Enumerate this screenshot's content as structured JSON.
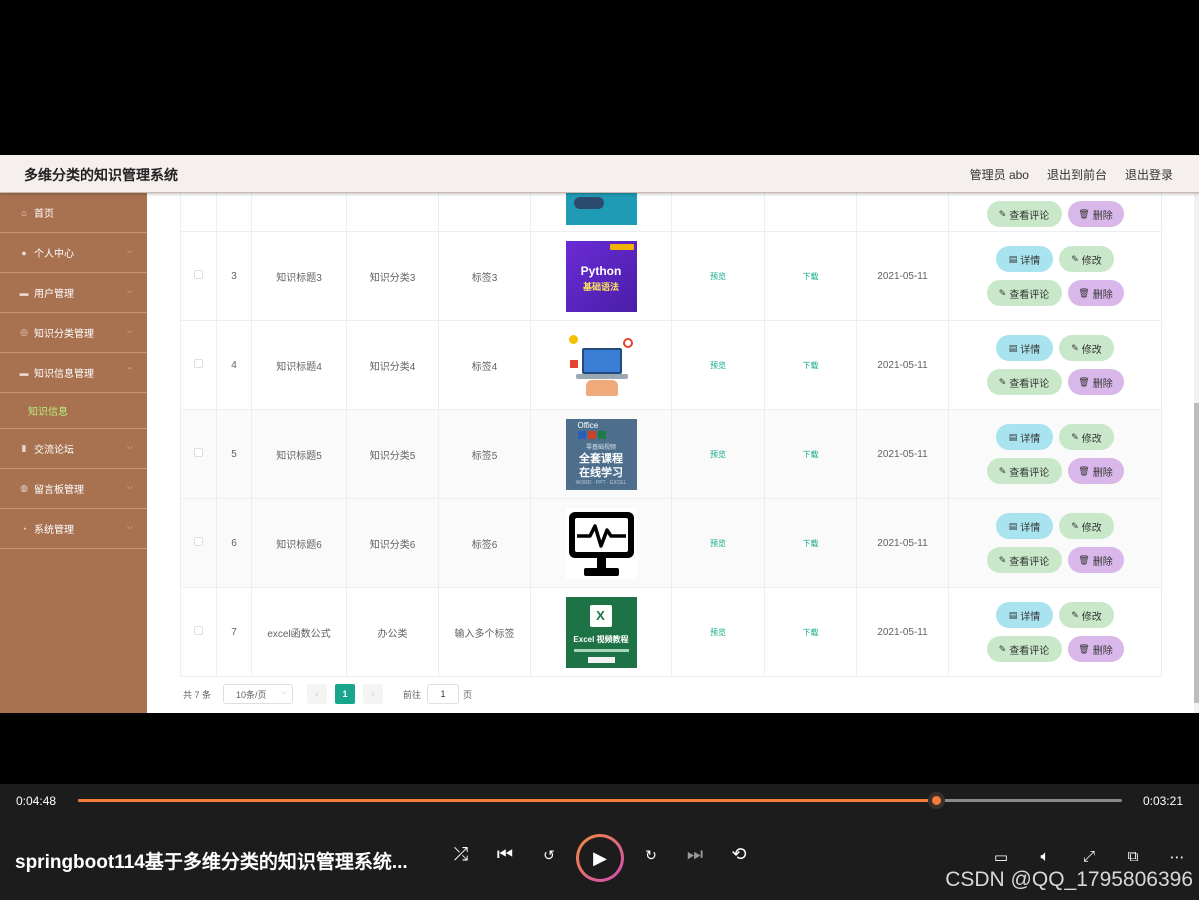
{
  "header": {
    "app_title": "多维分类的知识管理系统",
    "user_label": "管理员 abo",
    "front_link": "退出到前台",
    "logout_link": "退出登录"
  },
  "sidebar": {
    "items": [
      {
        "label": "首页",
        "icon": "home-icon"
      },
      {
        "label": "个人中心",
        "icon": "user-icon"
      },
      {
        "label": "用户管理",
        "icon": "list-icon"
      },
      {
        "label": "知识分类管理",
        "icon": "compass-icon"
      },
      {
        "label": "知识信息管理",
        "icon": "list-icon",
        "sub": "知识信息"
      },
      {
        "label": "交流论坛",
        "icon": "bar-chart-icon"
      },
      {
        "label": "留言板管理",
        "icon": "pin-icon"
      },
      {
        "label": "系统管理",
        "icon": "clock-icon"
      }
    ]
  },
  "table": {
    "preview_label": "预览",
    "download_label": "下载",
    "detail_label": "详情",
    "edit_label": "修改",
    "comment_label": "查看评论",
    "delete_label": "删除",
    "rows": [
      {
        "id": "3",
        "title": "知识标题3",
        "category": "知识分类3",
        "tag": "标签3",
        "date": "2021-05-11",
        "image": "Python 基础语法"
      },
      {
        "id": "4",
        "title": "知识标题4",
        "category": "知识分类4",
        "tag": "标签4",
        "date": "2021-05-11",
        "image": "laptop illustration"
      },
      {
        "id": "5",
        "title": "知识标题5",
        "category": "知识分类5",
        "tag": "标签5",
        "date": "2021-05-11",
        "image": "Office 全套课程 在线学习"
      },
      {
        "id": "6",
        "title": "知识标题6",
        "category": "知识分类6",
        "tag": "标签6",
        "date": "2021-05-11",
        "image": "monitor heartbeat icon"
      },
      {
        "id": "7",
        "title": "excel函数公式",
        "category": "办公类",
        "tag": "输入多个标签",
        "date": "2021-05-11",
        "image": "Excel 视频教程"
      }
    ]
  },
  "pagination": {
    "total": "共 7 条",
    "page_size": "10条/页",
    "current": "1",
    "goto_label": "前往",
    "goto_value": "1",
    "page_suffix": "页"
  },
  "player": {
    "elapsed": "0:04:48",
    "remaining": "0:03:21",
    "progress": 0.822,
    "title": "springboot114基于多维分类的知识管理系统...",
    "watermark": "CSDN @QQ_1795806396",
    "accent": "#f27c3a"
  },
  "thumbs": {
    "python_title": "Python",
    "python_sub": "基础语法",
    "office_top": "Office",
    "office_mid": "零基础视频",
    "office_l1": "全套课程",
    "office_l2": "在线学习",
    "office_foot": "WORD · PPT · EXCEL",
    "excel_title": "Excel 视频教程"
  }
}
